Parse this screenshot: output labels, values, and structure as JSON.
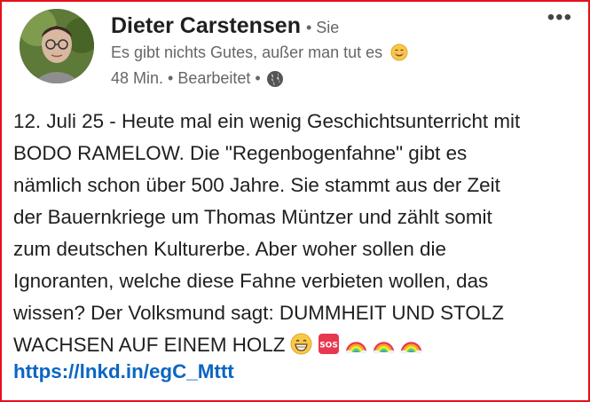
{
  "post": {
    "author_name": "Dieter Carstensen",
    "degree": "• Sie",
    "headline": "Es gibt nichts Gutes, außer man tut es",
    "timestamp": "48 Min. • Bearbeitet •",
    "visibility_icon": "globe-icon",
    "more_icon": "more-options-icon",
    "more_label": "•••",
    "body_lines": [
      "12. Juli 25 - Heute mal ein wenig Geschichtsunterricht mit",
      "BODO RAMELOW. Die \"Regenbogenfahne\" gibt es",
      "nämlich schon über 500 Jahre. Sie stammt aus der Zeit",
      "der Bauernkriege um Thomas Müntzer und zählt somit",
      "zum deutschen Kulturerbe. Aber woher sollen die",
      "Ignoranten, welche diese Fahne verbieten wollen, das",
      "wissen? Der Volksmund sagt: DUMMHEIT UND STOLZ",
      "WACHSEN AUF EINEM HOLZ"
    ],
    "trailing_emojis": [
      "grinning-face-emoji",
      "sos-emoji",
      "rainbow-emoji",
      "rainbow-emoji",
      "rainbow-emoji"
    ],
    "sos_label": "SOS",
    "link": "https://lnkd.in/egC_Mttt",
    "colors": {
      "frame": "#e8101a",
      "link": "#0a66c2",
      "secondary_text": "#666666"
    }
  }
}
